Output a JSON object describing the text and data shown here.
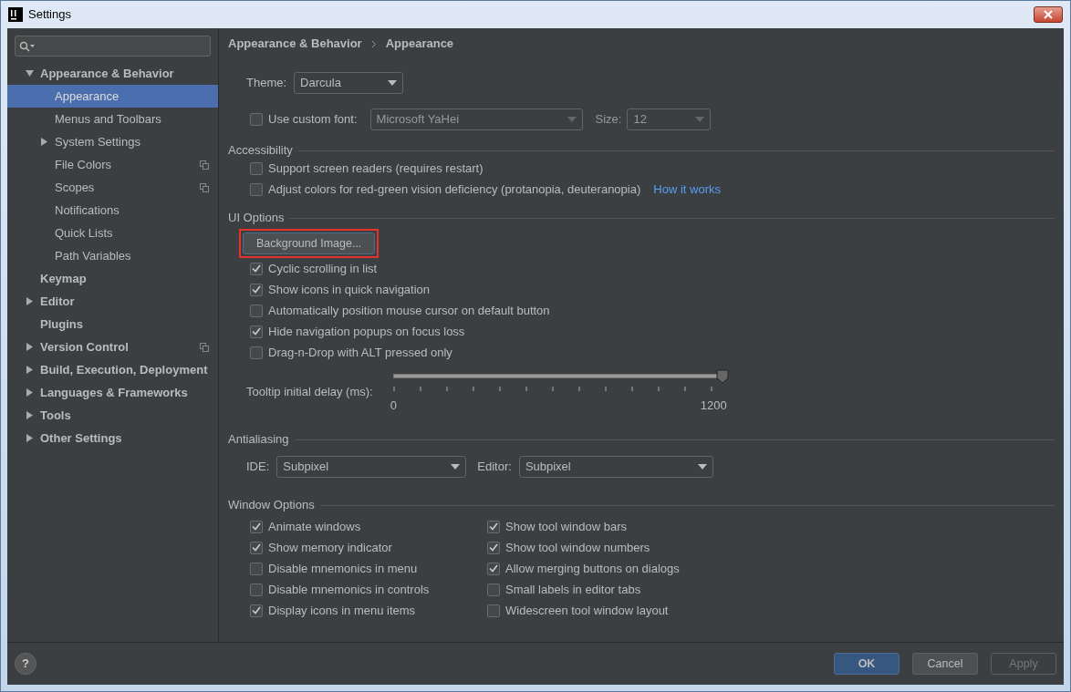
{
  "window": {
    "title": "Settings"
  },
  "sidebar": {
    "items": [
      {
        "label": "Appearance & Behavior",
        "expanded": true,
        "selected": false,
        "children": [
          {
            "label": "Appearance",
            "selected": true
          },
          {
            "label": "Menus and Toolbars",
            "selected": false
          },
          {
            "label": "System Settings",
            "selected": false,
            "expanded": false,
            "has_children": true
          },
          {
            "label": "File Colors",
            "selected": false,
            "project_icon": true
          },
          {
            "label": "Scopes",
            "selected": false,
            "project_icon": true
          },
          {
            "label": "Notifications",
            "selected": false
          },
          {
            "label": "Quick Lists",
            "selected": false
          },
          {
            "label": "Path Variables",
            "selected": false
          }
        ]
      },
      {
        "label": "Keymap",
        "selected": false
      },
      {
        "label": "Editor",
        "selected": false,
        "expanded": false,
        "has_children": true
      },
      {
        "label": "Plugins",
        "selected": false
      },
      {
        "label": "Version Control",
        "selected": false,
        "expanded": false,
        "has_children": true,
        "project_icon": true
      },
      {
        "label": "Build, Execution, Deployment",
        "selected": false,
        "expanded": false,
        "has_children": true
      },
      {
        "label": "Languages & Frameworks",
        "selected": false,
        "expanded": false,
        "has_children": true
      },
      {
        "label": "Tools",
        "selected": false,
        "expanded": false,
        "has_children": true
      },
      {
        "label": "Other Settings",
        "selected": false,
        "expanded": false,
        "has_children": true
      }
    ]
  },
  "breadcrumb": [
    "Appearance & Behavior",
    "Appearance"
  ],
  "theme": {
    "label": "Theme:",
    "value": "Darcula"
  },
  "custom_font": {
    "label": "Use custom font:",
    "checked": false,
    "font": "Microsoft YaHei",
    "size_label": "Size:",
    "size": "12",
    "disabled": true
  },
  "accessibility": {
    "title": "Accessibility",
    "options": [
      {
        "label": "Support screen readers (requires restart)",
        "checked": false
      },
      {
        "label": "Adjust colors for red-green vision deficiency (protanopia, deuteranopia)",
        "checked": false,
        "link": "How it works"
      }
    ]
  },
  "ui_options": {
    "title": "UI Options",
    "button": {
      "label": "Background Image...",
      "highlighted": true
    },
    "options": [
      {
        "label": "Cyclic scrolling in list",
        "checked": true
      },
      {
        "label": "Show icons in quick navigation",
        "checked": true
      },
      {
        "label": "Automatically position mouse cursor on default button",
        "checked": false
      },
      {
        "label": "Hide navigation popups on focus loss",
        "checked": true
      },
      {
        "label": "Drag-n-Drop with ALT pressed only",
        "checked": false
      }
    ],
    "tooltip_delay": {
      "label": "Tooltip initial delay (ms):",
      "level": 1,
      "min_label": "0",
      "max_label": "1200"
    }
  },
  "antialiasing": {
    "title": "Antialiasing",
    "ide_label": "IDE:",
    "ide": "Subpixel",
    "editor_label": "Editor:",
    "editor": "Subpixel"
  },
  "window_options": {
    "title": "Window Options",
    "columns": [
      [
        {
          "label": "Animate windows",
          "checked": true
        },
        {
          "label": "Show memory indicator",
          "checked": true
        },
        {
          "label": "Disable mnemonics in menu",
          "checked": false
        },
        {
          "label": "Disable mnemonics in controls",
          "checked": false
        },
        {
          "label": "Display icons in menu items",
          "checked": true
        }
      ],
      [
        {
          "label": "Show tool window bars",
          "checked": true
        },
        {
          "label": "Show tool window numbers",
          "checked": true
        },
        {
          "label": "Allow merging buttons on dialogs",
          "checked": true
        },
        {
          "label": "Small labels in editor tabs",
          "checked": false
        },
        {
          "label": "Widescreen tool window layout",
          "checked": false
        }
      ]
    ]
  },
  "help": {
    "label": "?"
  },
  "buttons": [
    {
      "label": "OK",
      "default": true,
      "disabled": false
    },
    {
      "label": "Cancel",
      "default": false,
      "disabled": false
    },
    {
      "label": "Apply",
      "default": false,
      "disabled": true
    }
  ]
}
